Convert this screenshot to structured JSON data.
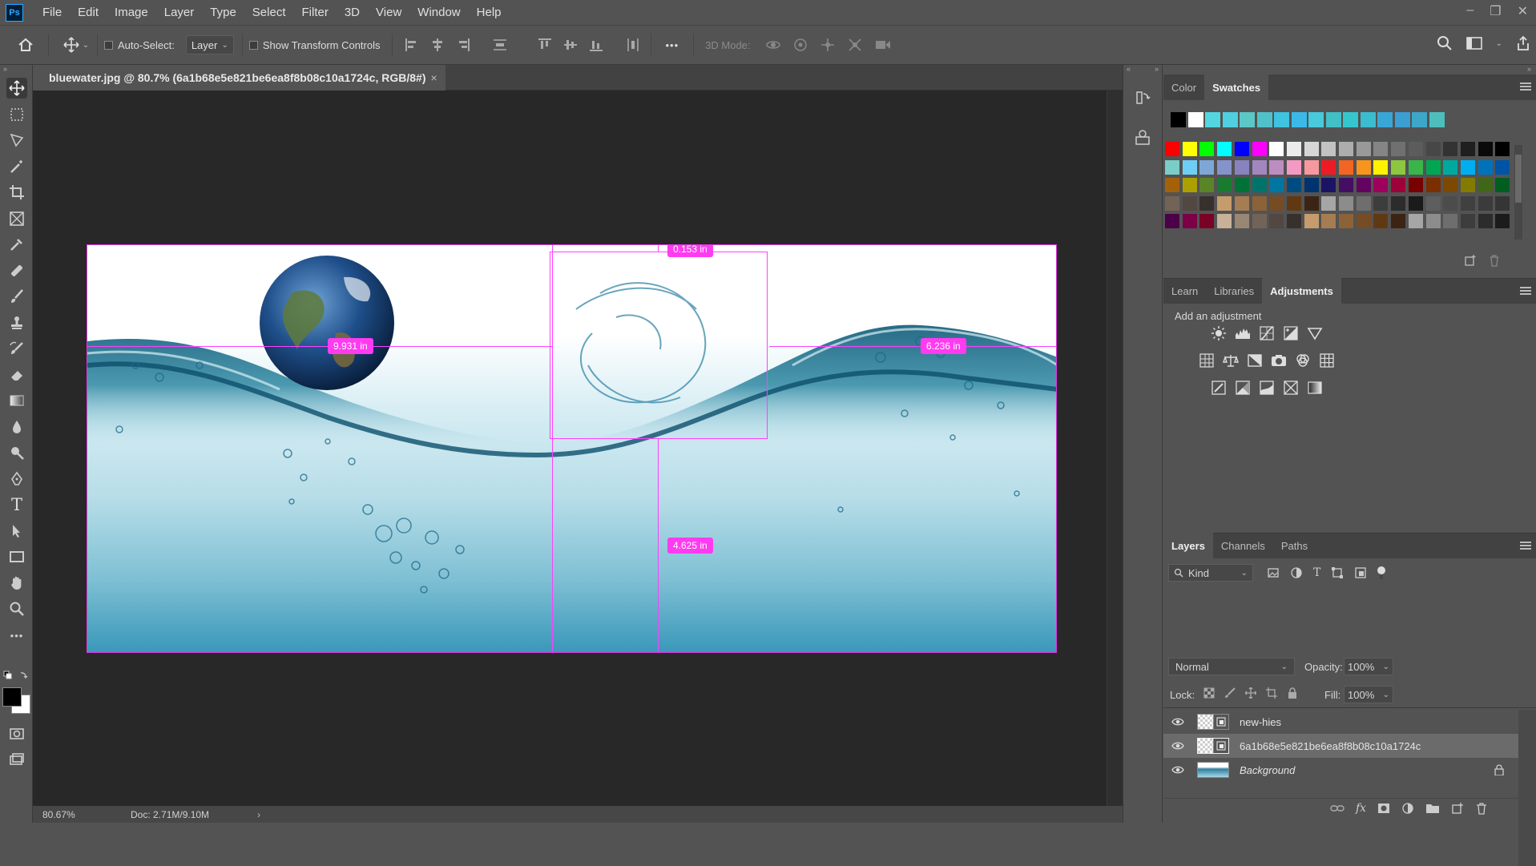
{
  "app": {
    "logo": "Ps"
  },
  "menu": [
    "File",
    "Edit",
    "Image",
    "Layer",
    "Type",
    "Select",
    "Filter",
    "3D",
    "View",
    "Window",
    "Help"
  ],
  "window_controls": {
    "minimize": "–",
    "restore": "❐",
    "close": "✕"
  },
  "options_bar": {
    "auto_select_label": "Auto-Select:",
    "auto_select_target": "Layer",
    "show_transform_label": "Show Transform Controls",
    "more": "•••",
    "mode_3d_label": "3D Mode:"
  },
  "document": {
    "tab_title": "bluewater.jpg @ 80.7% (6a1b68e5e821be6ea8f8b08c10a1724c, RGB/8#)",
    "close": "×"
  },
  "measurements": {
    "top": "0.153 in",
    "left": "9.931 in",
    "right": "6.236 in",
    "bottom": "4.625 in"
  },
  "status": {
    "zoom": "80.67%",
    "doc": "Doc: 2.71M/9.10M",
    "arrow": "›"
  },
  "color_panel": {
    "tabs": [
      "Color",
      "Swatches"
    ],
    "active_tab": "Swatches",
    "recent_swatches": [
      "#000000",
      "#ffffff",
      "#53d6df",
      "#4fcfe0",
      "#5bc7c7",
      "#4fc2c9",
      "#3ec4e0",
      "#3ab9e8",
      "#49c9dc",
      "#41c0c7",
      "#35c6cd",
      "#3bbccf",
      "#38a7d8",
      "#3c9fd3",
      "#3ca7c9",
      "#4dbebd"
    ],
    "swatch_rows": [
      [
        "#ff0000",
        "#ffff00",
        "#00ff00",
        "#00ffff",
        "#0000ff",
        "#ff00ff",
        "#ffffff",
        "#ebebeb",
        "#d6d6d6",
        "#c2c2c2",
        "#adadad",
        "#999999",
        "#858585",
        "#707070",
        "#5c5c5c",
        "#474747",
        "#333333",
        "#1f1f1f",
        "#0a0a0a",
        "#000000",
        "#f7977a",
        "#f9ad81",
        "#fdc68a",
        "#fff79a",
        "#c4df9b",
        "#a3d39c",
        "#82ca9d"
      ],
      [
        "#7bcdc8",
        "#6ecff6",
        "#7ea7d8",
        "#8493ca",
        "#8882be",
        "#a187be",
        "#bc8dbf",
        "#f49ac2",
        "#f6989d",
        "#ed1c24",
        "#f26522",
        "#f7941d",
        "#fff200",
        "#8dc73f",
        "#39b54a",
        "#00a651",
        "#00a99d",
        "#00aeef",
        "#0072bc",
        "#0054a6",
        "#2e3192",
        "#662d91",
        "#92278f",
        "#ec008c",
        "#ed145b",
        "#9e0b0f",
        "#a0410d"
      ],
      [
        "#a3620a",
        "#aba000",
        "#598527",
        "#197b30",
        "#007236",
        "#00746b",
        "#0076a3",
        "#004b80",
        "#003471",
        "#1b1464",
        "#440e62",
        "#630460",
        "#9e005d",
        "#9e0039",
        "#790000",
        "#7b2e00",
        "#7d4900",
        "#827b00",
        "#406618",
        "#005e20",
        "#005826",
        "#005952",
        "#005b7f",
        "#003663",
        "#002157",
        "#0d004c",
        "#32004b"
      ],
      [
        "#4b0049",
        "#7b0046",
        "#7a0026",
        "#c7b299",
        "#998675",
        "#736357",
        "#534741",
        "#37302d",
        "#c69c6d",
        "#a67c52",
        "#8c6239",
        "#754c24",
        "#603913",
        "#3c2415",
        "#a6a6a6",
        "#8c8c8c",
        "#6e6e6e",
        "#3d3d3d",
        "#2c2c2c",
        "#1b1b1b",
        "#5e5e5e",
        "#4c4c4c",
        "#404040",
        "#3b3b3b",
        "#353535",
        "#d8c6a8",
        "#a8978a"
      ]
    ]
  },
  "adjust_panel": {
    "tabs": [
      "Learn",
      "Libraries",
      "Adjustments"
    ],
    "active_tab": "Adjustments",
    "heading": "Add an adjustment",
    "icons_row1": [
      "brightness-contrast-icon",
      "levels-icon",
      "curves-icon",
      "exposure-icon",
      "vibrance-icon"
    ],
    "icons_row2": [
      "hue-saturation-icon",
      "color-balance-icon",
      "black-white-icon",
      "photo-filter-icon",
      "channel-mixer-icon",
      "color-lookup-icon"
    ],
    "icons_row3": [
      "invert-icon",
      "posterize-icon",
      "threshold-icon",
      "selective-color-icon",
      "gradient-map-icon"
    ]
  },
  "layers_panel": {
    "tabs": [
      "Layers",
      "Channels",
      "Paths"
    ],
    "active_tab": "Layers",
    "filter_label": "Kind",
    "blend_mode": "Normal",
    "opacity_label": "Opacity:",
    "opacity_value": "100%",
    "lock_label": "Lock:",
    "fill_label": "Fill:",
    "fill_value": "100%",
    "layers": [
      {
        "name": "new-hies",
        "selected": false,
        "italic": false,
        "locked": false
      },
      {
        "name": "6a1b68e5e821be6ea8f8b08c10a1724c",
        "selected": true,
        "italic": false,
        "locked": false
      },
      {
        "name": "Background",
        "selected": false,
        "italic": true,
        "locked": true
      }
    ],
    "footer_icons": [
      "link-icon",
      "fx-icon",
      "mask-icon",
      "adjustment-layer-icon",
      "group-icon",
      "new-layer-icon",
      "delete-icon"
    ]
  },
  "tools": [
    "move-tool",
    "marquee-tool",
    "lasso-tool",
    "magic-wand-tool",
    "crop-tool",
    "frame-tool",
    "eyedropper-tool",
    "healing-tool",
    "brush-tool",
    "stamp-tool",
    "history-brush-tool",
    "eraser-tool",
    "gradient-tool",
    "blur-tool",
    "dodge-tool",
    "pen-tool",
    "type-tool",
    "path-selection-tool",
    "rectangle-tool",
    "hand-tool",
    "zoom-tool",
    "more-tools"
  ],
  "type_tool_glyph": "T",
  "colors": {
    "accent": "#31a8ff",
    "measure": "#ff3bf1"
  }
}
